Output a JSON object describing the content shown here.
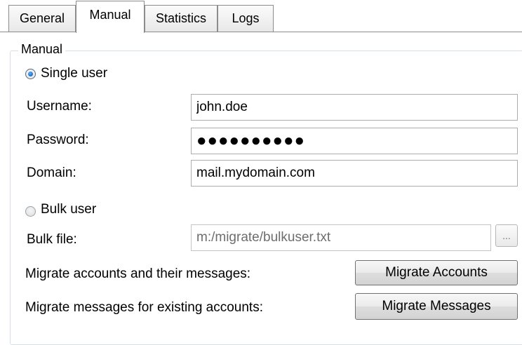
{
  "tabs": [
    {
      "label": "General",
      "active": false
    },
    {
      "label": "Manual",
      "active": true
    },
    {
      "label": "Statistics",
      "active": false
    },
    {
      "label": "Logs",
      "active": false
    }
  ],
  "manual": {
    "group_title": "Manual",
    "single_user": {
      "label": "Single user",
      "selected": true
    },
    "username": {
      "label": "Username:",
      "value": "john.doe"
    },
    "password": {
      "label": "Password:",
      "value": "●●●●●●●●●●"
    },
    "domain": {
      "label": "Domain:",
      "value": "mail.mydomain.com"
    },
    "bulk_user": {
      "label": "Bulk user",
      "selected": false
    },
    "bulk_file": {
      "label": "Bulk file:",
      "value": "m:/migrate/bulkuser.txt",
      "browse_label": "..."
    },
    "migrate_accounts": {
      "label": "Migrate accounts and their messages:",
      "button": "Migrate Accounts"
    },
    "migrate_messages": {
      "label": "Migrate messages for existing accounts:",
      "button": "Migrate Messages"
    }
  }
}
